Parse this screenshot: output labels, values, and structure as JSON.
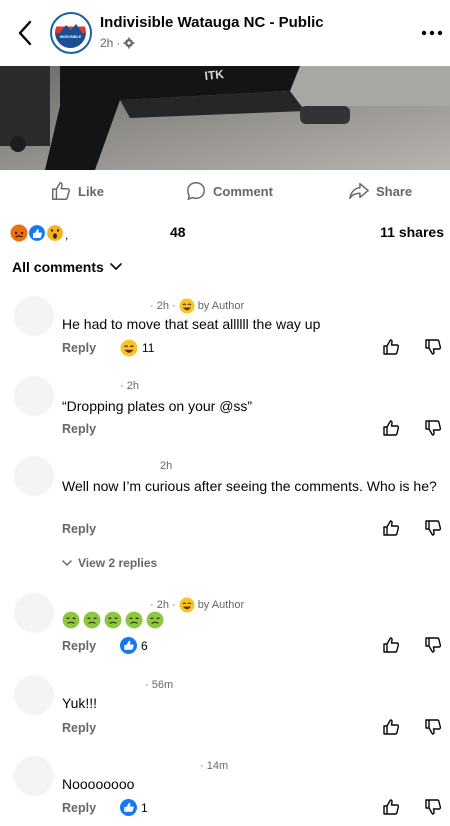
{
  "header": {
    "page_title": "Indivisible Watauga NC - Public",
    "post_time": "2h",
    "avatar_text": "INDIVISIBLE"
  },
  "actions": {
    "like": "Like",
    "comment": "Comment",
    "share": "Share"
  },
  "stats": {
    "reaction_count": "48",
    "shares": "11 shares"
  },
  "comments_header": "All comments",
  "comments": [
    {
      "meta_time": "· 2h ·",
      "author_tag": "by Author",
      "text": "He had to move that seat allllll the way up",
      "reply": "Reply",
      "reaction_count": "11"
    },
    {
      "meta_time": "· 2h",
      "text": "“Dropping plates on your @ss”",
      "reply": "Reply"
    },
    {
      "meta_time": "2h",
      "text": "Well now I’m curious after seeing the comments. Who is he?",
      "reply": "Reply",
      "view_replies": "View 2 replies"
    },
    {
      "meta_time": "· 2h ·",
      "author_tag": "by Author",
      "text": "",
      "reply": "Reply",
      "reaction_count": "6"
    },
    {
      "meta_time": "· 56m",
      "text": "Yuk!!!",
      "reply": "Reply"
    },
    {
      "meta_time": "· 14m",
      "text": "Noooooooo",
      "reply": "Reply",
      "reaction_count": "1"
    }
  ],
  "colors": {
    "accent": "#1877f2",
    "muted": "#65676b",
    "text": "#050505"
  }
}
